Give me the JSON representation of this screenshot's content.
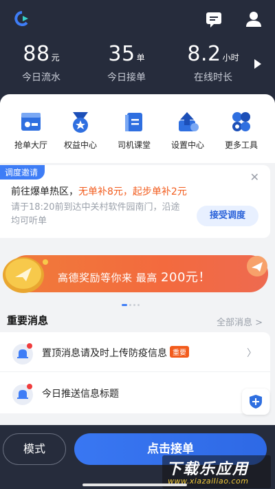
{
  "stats": [
    {
      "value": "88",
      "unit": "元",
      "label": "今日流水"
    },
    {
      "value": "35",
      "unit": "单",
      "label": "今日接单"
    },
    {
      "value": "8.2",
      "unit": "小时",
      "label": "在线时长"
    }
  ],
  "menu": [
    {
      "label": "抢单大厅",
      "icon": "order-hall-icon"
    },
    {
      "label": "权益中心",
      "icon": "medal-icon"
    },
    {
      "label": "司机课堂",
      "icon": "book-icon"
    },
    {
      "label": "设置中心",
      "icon": "upload-settings-icon"
    },
    {
      "label": "更多工具",
      "icon": "tools-icon"
    }
  ],
  "dispatch": {
    "tag": "调度邀请",
    "title_prefix": "前往爆单热区，",
    "title_highlight": "无单补8元，起步单补2元",
    "desc": "请于18:20前到达中关村软件园南门，沿途均可听单",
    "accept_label": "接受调度"
  },
  "banner": {
    "text": "高德奖励等你来 最高 ",
    "amount": "200元！"
  },
  "messages": {
    "title": "重要消息",
    "more_label": "全部消息 >",
    "items": [
      {
        "text": "置顶消息请及时上传防疫信息",
        "badge": "重要"
      },
      {
        "text": "今日推送信息标题",
        "badge": ""
      }
    ]
  },
  "bottom": {
    "mode_label": "模式",
    "grab_label": "点击接单"
  },
  "watermark": {
    "big": "下载乐应用",
    "small": "www.xiazaiIiao.com"
  },
  "colors": {
    "header_bg": "#262c3c",
    "accent_blue": "#3e7df6",
    "highlight_orange": "#f25b1c"
  }
}
